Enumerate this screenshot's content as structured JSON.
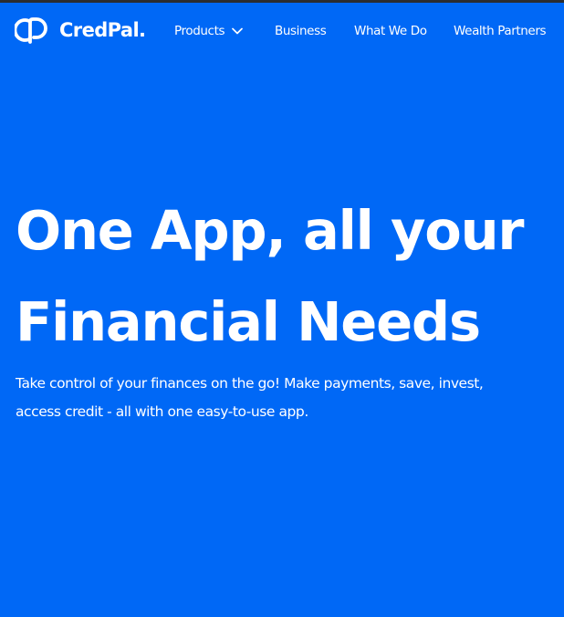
{
  "colors": {
    "background": "#0068f6",
    "text": "#ffffff",
    "top_strip": "#2b2d31"
  },
  "brand": {
    "name": "CredPal.",
    "logo_icon": "cp-monogram-icon"
  },
  "nav": {
    "items": [
      {
        "label": "Products",
        "icon": "chevron-down-icon"
      },
      {
        "label": "Business"
      },
      {
        "label": "What We Do"
      },
      {
        "label": "Wealth Partners"
      }
    ]
  },
  "hero": {
    "title_lines": [
      "One App, all your",
      "Financial Needs"
    ],
    "subtitle_lines": [
      "Take control of your finances on the go! Make payments, save, invest,",
      "access credit - all with one easy-to-use app."
    ]
  }
}
